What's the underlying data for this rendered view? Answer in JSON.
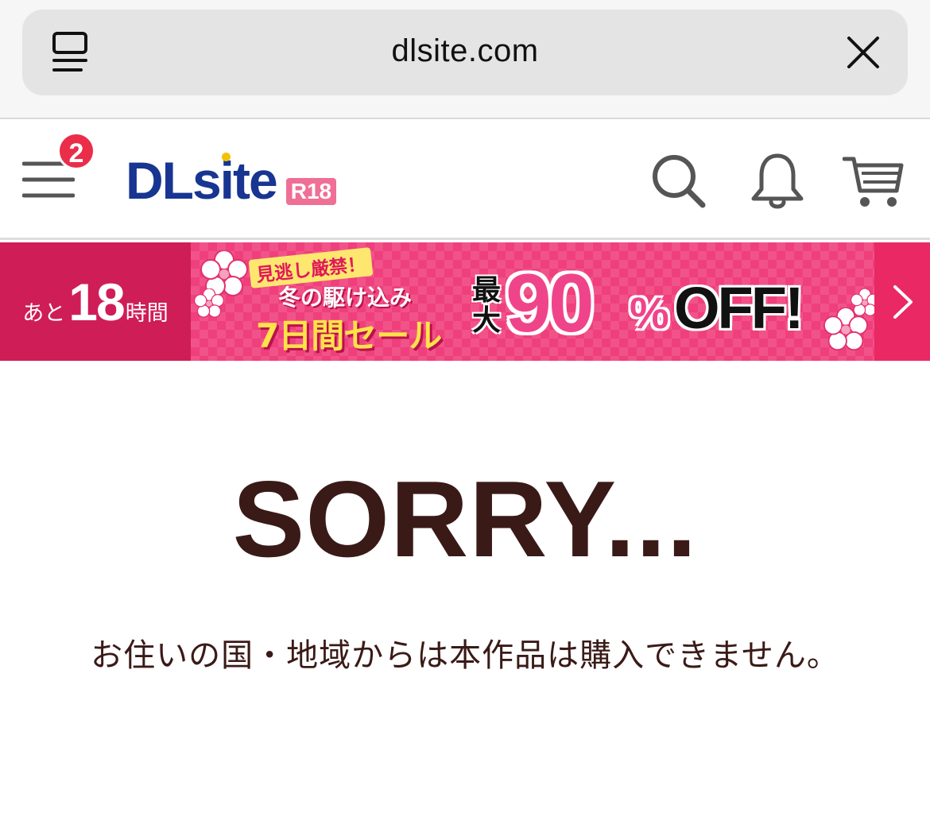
{
  "browser": {
    "url": "dlsite.com",
    "tabs_icon": "tab-overview-icon",
    "close_icon": "close-icon"
  },
  "header": {
    "menu_icon": "hamburger-menu-icon",
    "menu_badge": "2",
    "logo_text": "DLsite",
    "logo_badge": "R18",
    "search_icon": "search-icon",
    "notification_icon": "bell-icon",
    "cart_icon": "cart-icon"
  },
  "sale_banner": {
    "countdown_prefix": "あと",
    "countdown_value": "18",
    "countdown_unit": "時間",
    "pre_title": "見逃し厳禁！",
    "title_line1": "冬の駆け込み",
    "title_line2": "7日間セール",
    "discount_prefix": "最大",
    "discount_value": "90",
    "discount_unit": "%",
    "discount_suffix": "OFF!",
    "next_icon": "chevron-right-icon",
    "colors": {
      "background": "#ea2864",
      "countdown_background": "#cf1d58"
    }
  },
  "main": {
    "heading": "SORRY...",
    "message": "お住いの国・地域からは本作品は購入できません。"
  },
  "colors": {
    "text": "#3a1a17",
    "logo": "#173591",
    "badge": "#ea2d49"
  }
}
